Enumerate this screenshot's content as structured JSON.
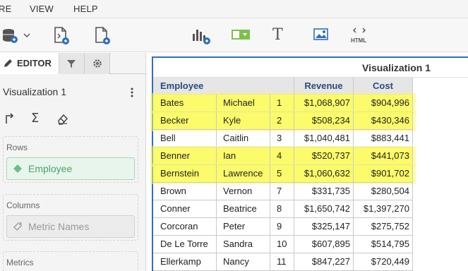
{
  "menu": {
    "items": [
      "RE",
      "VIEW",
      "HELP"
    ]
  },
  "toolbar": {
    "icons": [
      "datasource-icon",
      "add-dataset-icon",
      "new-document-icon",
      "add-chart-icon",
      "grid-visualization-icon",
      "text-icon",
      "image-icon",
      "html-icon"
    ],
    "html_label": "HTML",
    "text_glyph": "T"
  },
  "editor": {
    "tab_label": "EDITOR",
    "viz_name": "Visualization 1",
    "rows_label": "Rows",
    "rows_item": "Employee",
    "columns_label": "Columns",
    "columns_item": "Metric Names",
    "metrics_label": "Metrics"
  },
  "visualization": {
    "title": "Visualization 1",
    "headers": {
      "employee": "Employee",
      "revenue": "Revenue",
      "cost": "Cost"
    },
    "rows": [
      {
        "last": "Bates",
        "first": "Michael",
        "n": "1",
        "revenue": "$1,068,907",
        "cost": "$904,996",
        "highlight": true
      },
      {
        "last": "Becker",
        "first": "Kyle",
        "n": "2",
        "revenue": "$508,234",
        "cost": "$430,346",
        "highlight": true
      },
      {
        "last": "Bell",
        "first": "Caitlin",
        "n": "3",
        "revenue": "$1,040,481",
        "cost": "$883,441",
        "highlight": false
      },
      {
        "last": "Benner",
        "first": "Ian",
        "n": "4",
        "revenue": "$520,737",
        "cost": "$441,073",
        "highlight": true
      },
      {
        "last": "Bernstein",
        "first": "Lawrence",
        "n": "5",
        "revenue": "$1,060,632",
        "cost": "$901,702",
        "highlight": true
      },
      {
        "last": "Brown",
        "first": "Vernon",
        "n": "7",
        "revenue": "$331,735",
        "cost": "$280,504",
        "highlight": false
      },
      {
        "last": "Conner",
        "first": "Beatrice",
        "n": "8",
        "revenue": "$1,650,742",
        "cost": "$1,397,270",
        "highlight": false
      },
      {
        "last": "Corcoran",
        "first": "Peter",
        "n": "9",
        "revenue": "$325,147",
        "cost": "$275,752",
        "highlight": false
      },
      {
        "last": "De Le Torre",
        "first": "Sandra",
        "n": "10",
        "revenue": "$607,895",
        "cost": "$514,795",
        "highlight": false
      },
      {
        "last": "Ellerkamp",
        "first": "Nancy",
        "n": "11",
        "revenue": "$847,227",
        "cost": "$720,449",
        "highlight": false
      }
    ]
  },
  "colors": {
    "highlight": "#fbfb6b",
    "accent": "#2f6fbf",
    "employee_green": "#4aa36c",
    "header_text": "#2b4a80"
  }
}
